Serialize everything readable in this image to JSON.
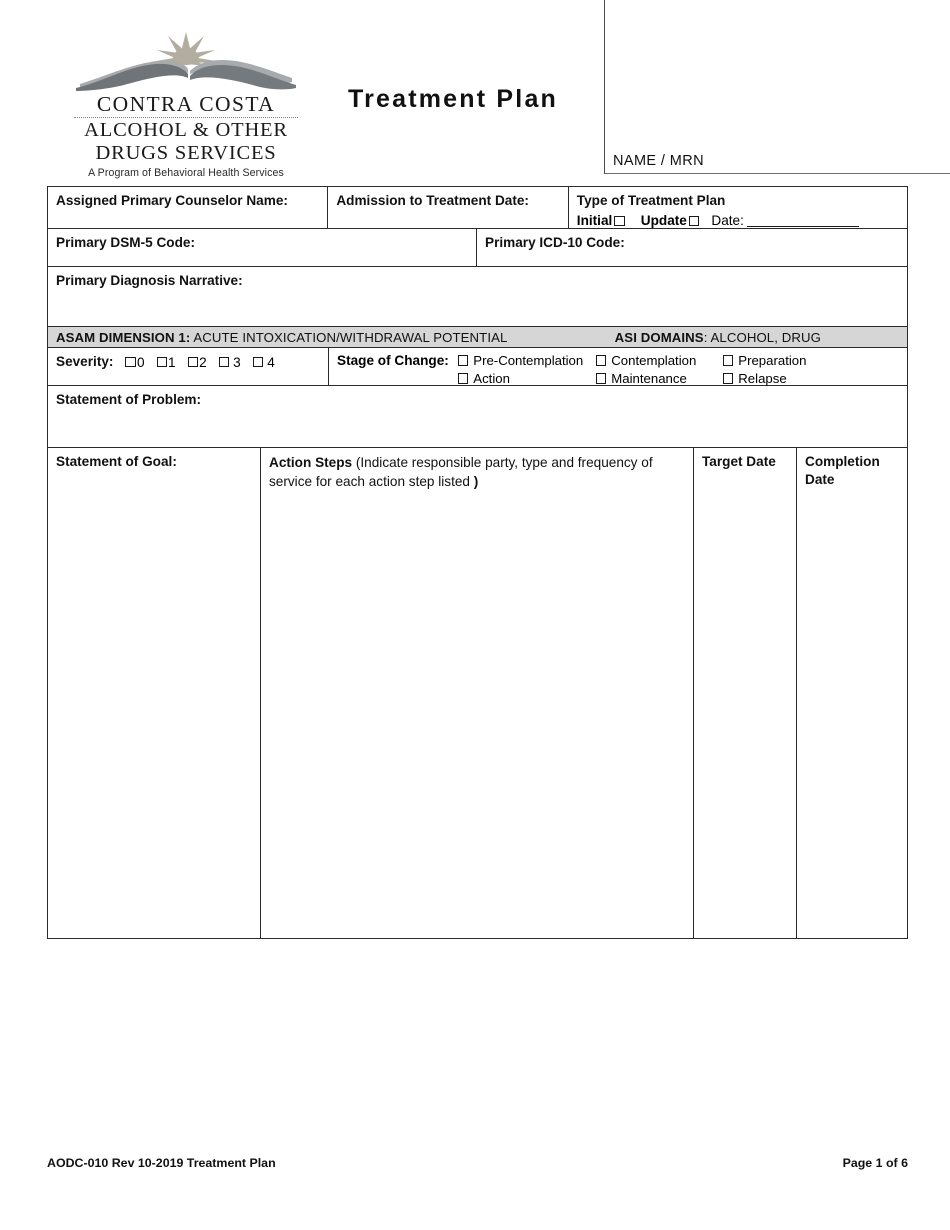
{
  "document": {
    "title": "Treatment Plan",
    "form_code": "AODC-010 Rev 10-2019 Treatment Plan",
    "page_number": "Page 1 of 6"
  },
  "logo": {
    "line1": "CONTRA COSTA",
    "line2": "ALCOHOL & OTHER",
    "line3": "DRUGS SERVICES",
    "tagline": "A Program of Behavioral Health Services",
    "mark_name": "sunburst-over-mountains-logo",
    "colors": {
      "sun": "#b3ada0",
      "ridge_dark": "#6f7479",
      "ridge_light": "#a7abae"
    }
  },
  "mrn_box": {
    "label": "NAME / MRN"
  },
  "form": {
    "row_counselor": {
      "counselor_label": "Assigned Primary Counselor Name:",
      "admission_label": "Admission to Treatment Date:",
      "type_label": "Type of Treatment Plan",
      "initial_label": "Initial",
      "update_label": "Update",
      "date_label": "Date:"
    },
    "row_codes": {
      "dsm_label": "Primary DSM-5 Code:",
      "icd_label": "Primary ICD-10 Code:"
    },
    "row_narrative": {
      "label": "Primary Diagnosis Narrative:"
    },
    "asam_banner": {
      "dimension_label": "ASAM DIMENSION 1:",
      "dimension_text": " ACUTE INTOXICATION/WITHDRAWAL POTENTIAL",
      "asi_label": "ASI DOMAINS",
      "asi_text": ": ALCOHOL, DRUG"
    },
    "row_severity": {
      "severity_label": "Severity:",
      "severity_options": [
        "0",
        "1",
        "2",
        "3",
        "4"
      ],
      "stage_label": "Stage of Change:",
      "stage_options": [
        "Pre-Contemplation",
        "Contemplation",
        "Preparation",
        "Action",
        "Maintenance",
        "Relapse"
      ]
    },
    "row_problem": {
      "label": "Statement of Problem:"
    },
    "row_goal": {
      "goal_label": "Statement of Goal:",
      "action_label": "Action Steps",
      "action_note": " (Indicate responsible party, type and frequency of service for each action step listed ",
      "action_close": ")",
      "target_date_label": "Target Date",
      "completion_date_label": "Completion Date"
    }
  }
}
